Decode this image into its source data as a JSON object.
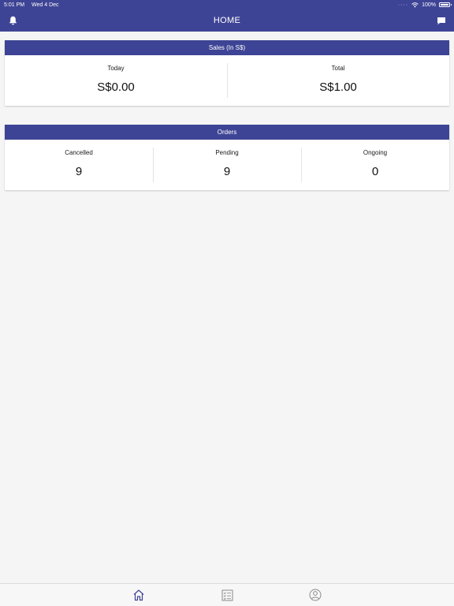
{
  "status_bar": {
    "time": "5:01 PM",
    "date": "Wed 4 Dec",
    "battery": "100%"
  },
  "header": {
    "title": "HOME"
  },
  "sales": {
    "title": "Sales (In S$)",
    "metrics": [
      {
        "label": "Today",
        "value": "S$0.00"
      },
      {
        "label": "Total",
        "value": "S$1.00"
      }
    ]
  },
  "orders": {
    "title": "Orders",
    "metrics": [
      {
        "label": "Cancelled",
        "value": "9"
      },
      {
        "label": "Pending",
        "value": "9"
      },
      {
        "label": "Ongoing",
        "value": "0"
      }
    ]
  },
  "tabs": [
    {
      "icon": "home-icon",
      "active": true
    },
    {
      "icon": "checklist-icon",
      "active": false
    },
    {
      "icon": "profile-icon",
      "active": false
    }
  ],
  "colors": {
    "primary": "#3e4495",
    "tab_active": "#3e4495",
    "tab_inactive": "#8a8a8a"
  }
}
